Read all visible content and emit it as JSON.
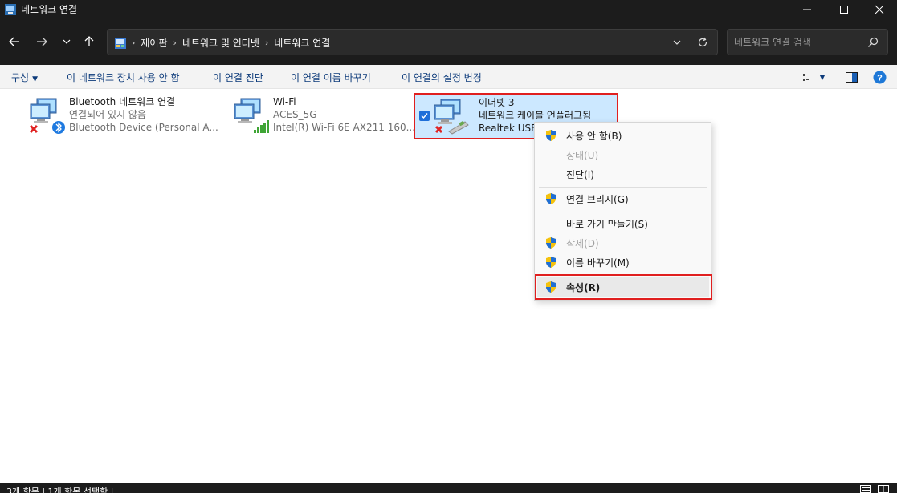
{
  "window": {
    "title": "네트워크 연결",
    "minimize_icon": "minimize-icon",
    "maximize_icon": "maximize-icon",
    "close_icon": "close-icon"
  },
  "address": {
    "breadcrumbs": [
      "제어판",
      "네트워크 및 인터넷",
      "네트워크 연결"
    ],
    "search_placeholder": "네트워크 연결 검색"
  },
  "commands": {
    "organize": "구성",
    "disable": "이 네트워크 장치 사용 안 함",
    "diagnose": "이 연결 진단",
    "rename": "이 연결 이름 바꾸기",
    "change_settings": "이 연결의 설정 변경"
  },
  "connections": [
    {
      "name": "Bluetooth 네트워크 연결",
      "status": "연결되어 있지 않음",
      "device": "Bluetooth Device (Personal A...",
      "icon": "bluetooth-adapter-icon",
      "disconnected": true
    },
    {
      "name": "Wi-Fi",
      "status": "ACES_5G",
      "device": "Intel(R) Wi-Fi 6E AX211 160...",
      "icon": "wifi-adapter-icon",
      "disconnected": false
    },
    {
      "name": "이더넷 3",
      "status": "네트워크 케이블 언플러그됨",
      "device": "Realtek USB",
      "icon": "ethernet-adapter-icon",
      "disconnected": true,
      "selected": true
    }
  ],
  "context_menu": {
    "items": [
      {
        "label": "사용 안 함(B)",
        "shield": true,
        "disabled": false
      },
      {
        "label": "상태(U)",
        "shield": false,
        "disabled": true
      },
      {
        "label": "진단(I)",
        "shield": false,
        "disabled": false
      },
      {
        "label": "연결 브리지(G)",
        "shield": true,
        "disabled": false
      },
      {
        "label": "바로 가기 만들기(S)",
        "shield": false,
        "disabled": false
      },
      {
        "label": "삭제(D)",
        "shield": true,
        "disabled": true
      },
      {
        "label": "이름 바꾸기(M)",
        "shield": true,
        "disabled": false
      },
      {
        "label": "속성(R)",
        "shield": true,
        "disabled": false,
        "bold": true,
        "highlighted": true
      }
    ]
  },
  "status_bar": {
    "text": "3개 항목  |  1개 항목 선택함  |"
  },
  "colors": {
    "dark_chrome": "#1c1c1c",
    "selection": "#cce8ff",
    "highlight_box": "#e01f1f",
    "command_text": "#0c3a7a"
  }
}
